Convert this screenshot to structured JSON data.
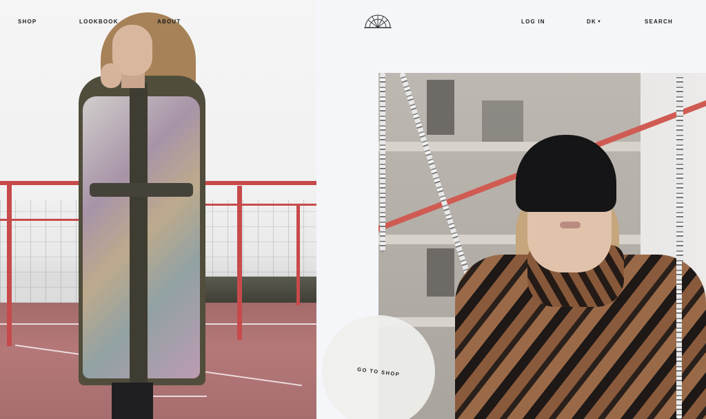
{
  "nav": {
    "left": [
      {
        "label": "SHOP"
      },
      {
        "label": "LOOKBOOK"
      },
      {
        "label": "ABOUT"
      }
    ],
    "right": {
      "login": "LOG IN",
      "currency": "DK",
      "search": "SEARCH"
    },
    "logo_icon": "half-sun-icon"
  },
  "hero": {
    "cta_label": "GO TO SHOP"
  },
  "colors": {
    "background": "#f4f6fa",
    "text": "#1d1d1d",
    "cta_circle": "#efefed"
  }
}
